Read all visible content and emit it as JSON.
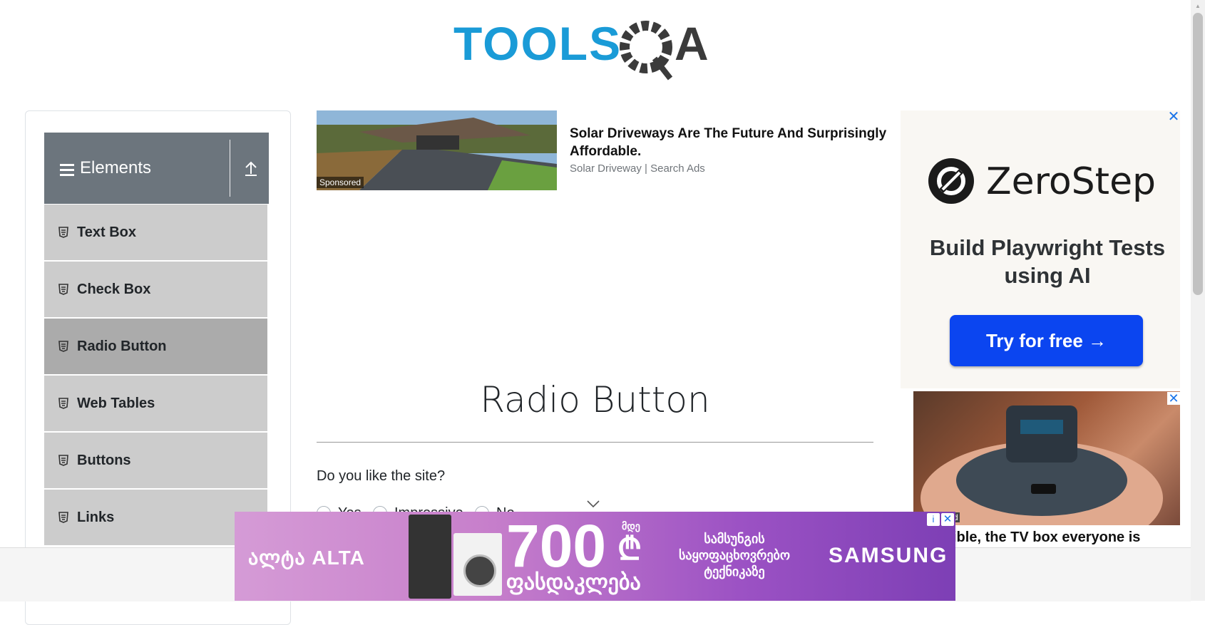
{
  "header": {
    "logo_text": "TOOLSQA"
  },
  "sidebar": {
    "group_title": "Elements",
    "items": [
      {
        "label": "Text Box"
      },
      {
        "label": "Check Box"
      },
      {
        "label": "Radio Button",
        "active": true
      },
      {
        "label": "Web Tables"
      },
      {
        "label": "Buttons"
      },
      {
        "label": "Links"
      }
    ]
  },
  "ad_top": {
    "title": "Solar Driveways Are The Future And Surprisingly Affordable.",
    "source": "Solar Driveway | Search Ads",
    "badge": "Sponsored"
  },
  "main": {
    "title": "Radio Button",
    "question": "Do you like the site?",
    "options": [
      {
        "label": "Yes"
      },
      {
        "label": "Impressive"
      },
      {
        "label": "No"
      }
    ]
  },
  "ad_right": {
    "brand": "ZeroStep",
    "tagline": "Build Playwright Tests using AI",
    "cta": "Try for free →",
    "close": "✕"
  },
  "ad_right2": {
    "caption": "ible, the TV box everyone is",
    "close": "✕",
    "badge": "d"
  },
  "ad_bottom": {
    "brand": "ალტა ALTA",
    "amount": "700",
    "currency_prefix": "მდე",
    "currency": "₾",
    "discount": "ფასდაკლება",
    "description": "სამსუნგის საყოფაცხოვრებო ტექნიკაზე",
    "partner": "SAMSUNG",
    "info": "i",
    "close": "✕"
  },
  "colors": {
    "accent_blue": "#1a9bd7",
    "sidebar_header": "#6c757d",
    "cta_blue": "#0b45f0"
  }
}
